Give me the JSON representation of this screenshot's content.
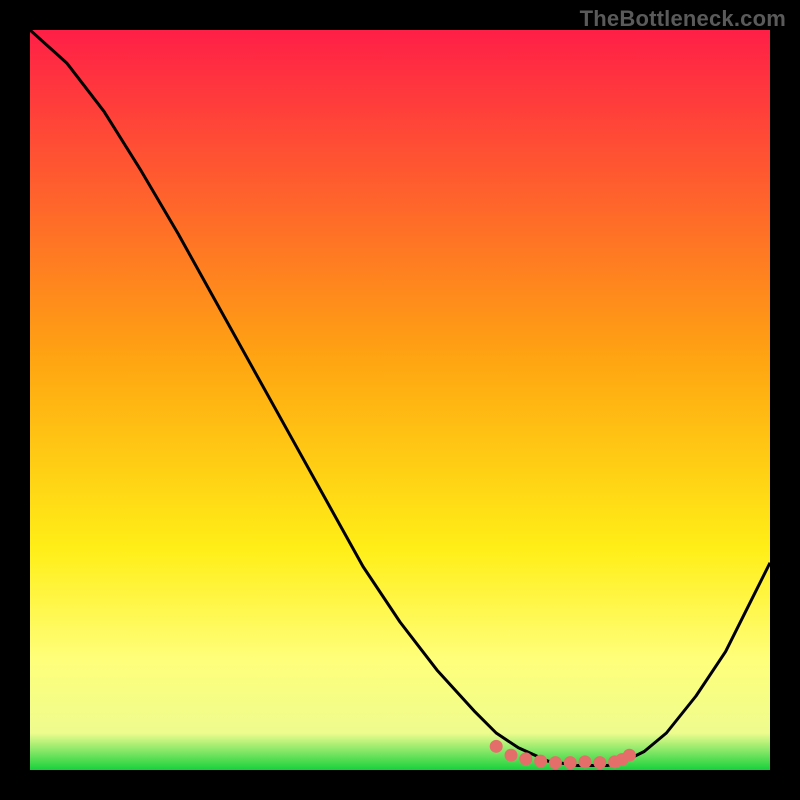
{
  "watermark": "TheBottleneck.com",
  "chart_data": {
    "type": "line",
    "title": "",
    "xlabel": "",
    "ylabel": "",
    "xlim": [
      0,
      100
    ],
    "ylim": [
      0,
      100
    ],
    "grid": false,
    "legend": false,
    "curve_x": [
      0,
      5,
      10,
      15,
      20,
      25,
      30,
      35,
      40,
      45,
      50,
      55,
      60,
      63,
      66,
      70,
      74,
      78,
      80,
      83,
      86,
      90,
      94,
      97,
      100
    ],
    "curve_y": [
      100,
      95.5,
      89,
      81,
      72.5,
      63.5,
      54.5,
      45.5,
      36.5,
      27.5,
      20,
      13.5,
      8,
      5,
      3,
      1.2,
      0.6,
      0.6,
      1,
      2.5,
      5,
      10,
      16,
      22,
      28
    ],
    "markers_x": [
      63,
      65,
      67,
      69,
      71,
      73,
      75,
      77,
      79,
      80,
      81
    ],
    "markers_y": [
      3.2,
      2,
      1.5,
      1.2,
      1,
      1,
      1.1,
      1,
      1.1,
      1.4,
      2
    ],
    "optimal_band_y": [
      0,
      3
    ],
    "gradient_stops": [
      {
        "offset": 0,
        "color": "#ff1f47"
      },
      {
        "offset": 45,
        "color": "#ffa611"
      },
      {
        "offset": 70,
        "color": "#ffee17"
      },
      {
        "offset": 85,
        "color": "#ffff7a"
      },
      {
        "offset": 95,
        "color": "#eefc8e"
      },
      {
        "offset": 100,
        "color": "#18d13c"
      }
    ],
    "marker_color": "#e46f6a",
    "curve_color": "#000000"
  }
}
